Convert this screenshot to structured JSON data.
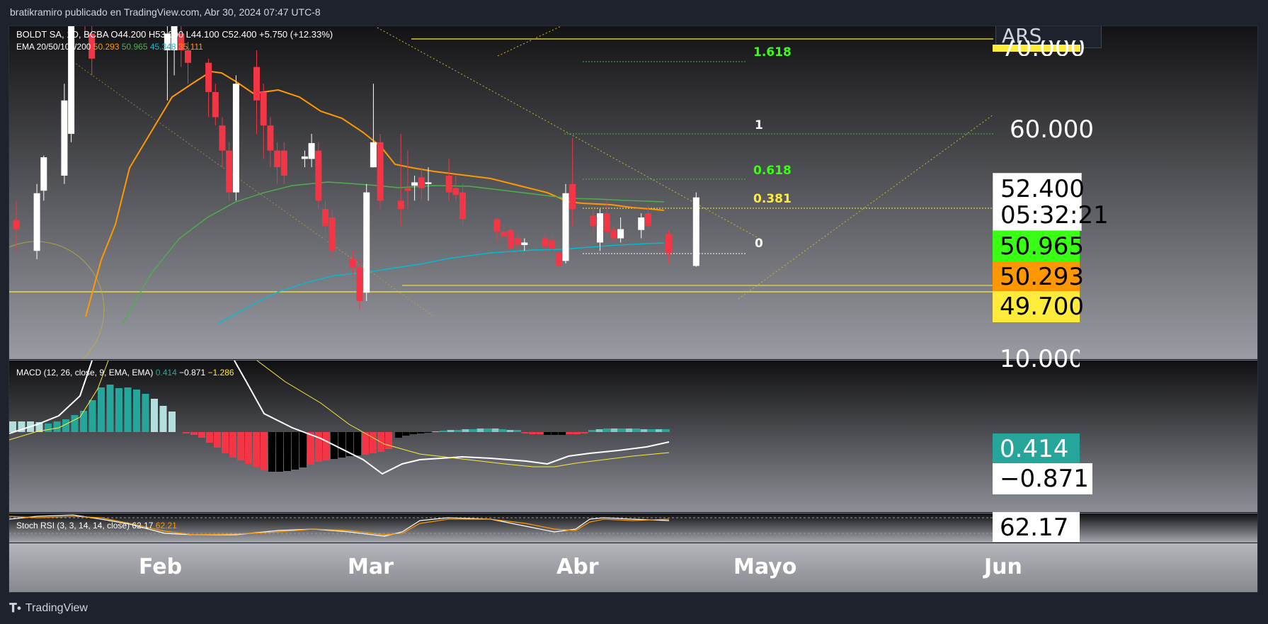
{
  "header": {
    "text": "bratikramiro publicado en TradingView.com, Abr 30, 2024 07:47 UTC-8"
  },
  "footer": {
    "brand": "TradingView"
  },
  "main": {
    "symbol_line": "BOLDT SA, 1D, BCBA  O44.200  H53.000  L44.100  C52.400  +5.750 (+12.33%)",
    "ema_label": "EMA 20/50/100/200",
    "ema_values": [
      "50.293",
      "50.965",
      "45.348",
      "35.111"
    ],
    "currency": "ARS",
    "price_axis": [
      "70.000",
      "60.000",
      "10.000"
    ],
    "last_price": "52.400",
    "countdown": "05:32:21",
    "ema50_tag": "50.965",
    "ema20_tag": "50.293",
    "level_tag": "49.700",
    "fib": [
      "1.618",
      "1",
      "0.618",
      "0.381",
      "0"
    ]
  },
  "macd": {
    "label": "MACD (12, 26, close, 9, EMA, EMA)",
    "values": [
      "0.414",
      "−0.871",
      "−1.286"
    ],
    "hist_tag": "0.414",
    "macd_tag": "−0.871"
  },
  "rsi": {
    "label": "Stoch RSI (3, 3, 14, 14, close)",
    "values": [
      "62.17",
      "62.21"
    ],
    "tag": "62.17"
  },
  "time_axis": [
    "Feb",
    "Mar",
    "Abr",
    "Mayo",
    "Jun"
  ],
  "colors": {
    "up": "#ffffff",
    "down": "#f23645",
    "ema20": "#ff9800",
    "ema50": "#4caf50",
    "ema100": "#00bcd4",
    "ema50_tag": "#39ff14",
    "ema20_tag": "#ff9800",
    "level_tag": "#ffeb3b",
    "macd_tag": "#26a69a"
  },
  "chart_data": {
    "type": "candlestick",
    "candles": [
      {
        "d": "2024-01-22",
        "o": 49.7,
        "c": 48.6,
        "h": 52,
        "l": 46
      },
      {
        "d": "2024-01-25",
        "o": 46,
        "c": 52.9,
        "h": 54,
        "l": 45
      },
      {
        "d": "2024-01-26",
        "o": 53.2,
        "c": 57.2,
        "h": 57.4,
        "l": 52
      },
      {
        "d": "2024-01-29",
        "o": 55,
        "c": 64,
        "h": 66,
        "l": 54
      },
      {
        "d": "2024-01-30",
        "o": 60,
        "c": 80,
        "h": 82,
        "l": 59
      },
      {
        "d": "2024-02-01",
        "o": 78,
        "c": 75,
        "h": 82,
        "l": 72
      },
      {
        "d": "2024-02-02",
        "o": 72,
        "c": 69,
        "h": 74,
        "l": 67
      },
      {
        "d": "2024-02-13",
        "o": 70,
        "c": 72,
        "h": 74,
        "l": 64
      },
      {
        "d": "2024-02-14",
        "o": 70,
        "c": 75,
        "h": 76,
        "l": 67
      },
      {
        "d": "2024-02-15",
        "o": 72,
        "c": 70,
        "h": 74,
        "l": 68
      },
      {
        "d": "2024-02-16",
        "o": 70,
        "c": 68.5,
        "h": 71,
        "l": 66
      },
      {
        "d": "2024-02-19",
        "o": 68.5,
        "c": 65,
        "h": 69,
        "l": 62
      },
      {
        "d": "2024-02-20",
        "o": 65,
        "c": 62,
        "h": 66,
        "l": 61
      },
      {
        "d": "2024-02-21",
        "o": 61,
        "c": 58,
        "h": 62,
        "l": 56
      },
      {
        "d": "2024-02-22",
        "o": 58,
        "c": 53,
        "h": 59,
        "l": 52
      },
      {
        "d": "2024-02-23",
        "o": 53,
        "c": 66,
        "h": 67,
        "l": 52
      },
      {
        "d": "2024-02-26",
        "o": 68,
        "c": 64,
        "h": 70,
        "l": 60
      },
      {
        "d": "2024-02-27",
        "o": 65,
        "c": 61,
        "h": 66,
        "l": 57
      },
      {
        "d": "2024-02-28",
        "o": 61,
        "c": 58,
        "h": 62,
        "l": 56
      },
      {
        "d": "2024-02-29",
        "o": 58,
        "c": 56,
        "h": 59,
        "l": 54
      },
      {
        "d": "2024-03-01",
        "o": 58,
        "c": 55,
        "h": 59,
        "l": 54
      },
      {
        "d": "2024-03-04",
        "o": 57,
        "c": 57.3,
        "h": 58,
        "l": 56
      },
      {
        "d": "2024-03-05",
        "o": 57,
        "c": 58.9,
        "h": 60,
        "l": 56
      },
      {
        "d": "2024-03-06",
        "o": 58,
        "c": 52,
        "h": 59,
        "l": 51
      },
      {
        "d": "2024-03-07",
        "o": 51,
        "c": 49,
        "h": 52,
        "l": 47
      },
      {
        "d": "2024-03-08",
        "o": 50,
        "c": 46,
        "h": 51,
        "l": 45
      },
      {
        "d": "2024-03-11",
        "o": 45,
        "c": 44,
        "h": 46,
        "l": 43
      },
      {
        "d": "2024-03-12",
        "o": 44,
        "c": 40,
        "h": 45,
        "l": 39
      },
      {
        "d": "2024-03-13",
        "o": 41,
        "c": 53,
        "h": 54,
        "l": 40
      },
      {
        "d": "2024-03-14",
        "o": 56,
        "c": 59,
        "h": 66,
        "l": 56
      },
      {
        "d": "2024-03-15",
        "o": 59,
        "c": 52,
        "h": 60,
        "l": 51
      },
      {
        "d": "2024-03-18",
        "o": 52,
        "c": 51,
        "h": 60,
        "l": 49
      },
      {
        "d": "2024-03-19",
        "o": 53.5,
        "c": 53.2,
        "h": 58,
        "l": 51
      },
      {
        "d": "2024-03-20",
        "o": 53.8,
        "c": 54.2,
        "h": 55,
        "l": 52
      },
      {
        "d": "2024-03-21",
        "o": 54.8,
        "c": 53.5,
        "h": 56,
        "l": 52
      },
      {
        "d": "2024-03-22",
        "o": 54,
        "c": 54.2,
        "h": 56,
        "l": 52
      },
      {
        "d": "2024-03-25",
        "o": 55,
        "c": 53,
        "h": 57,
        "l": 52
      },
      {
        "d": "2024-03-26",
        "o": 53.5,
        "c": 52.7,
        "h": 55,
        "l": 52
      },
      {
        "d": "2024-03-27",
        "o": 53,
        "c": 49.8,
        "h": 54,
        "l": 49
      },
      {
        "d": "2024-04-01",
        "o": 49.8,
        "c": 48.3,
        "h": 50,
        "l": 47
      },
      {
        "d": "2024-04-02",
        "o": 48.3,
        "c": 47.7,
        "h": 49,
        "l": 47
      },
      {
        "d": "2024-04-03",
        "o": 48.5,
        "c": 46.3,
        "h": 49,
        "l": 45.5
      },
      {
        "d": "2024-04-04",
        "o": 47.5,
        "c": 46.7,
        "h": 48,
        "l": 45.5
      },
      {
        "d": "2024-04-05",
        "o": 46.7,
        "c": 47,
        "h": 47.5,
        "l": 46
      },
      {
        "d": "2024-04-08",
        "o": 47.5,
        "c": 46.5,
        "h": 48,
        "l": 45.5
      },
      {
        "d": "2024-04-09",
        "o": 47.3,
        "c": 46.2,
        "h": 48,
        "l": 45.5
      },
      {
        "d": "2024-04-10",
        "o": 45.8,
        "c": 44.2,
        "h": 46,
        "l": 44
      },
      {
        "d": "2024-04-11",
        "o": 44.8,
        "c": 52.9,
        "h": 54,
        "l": 44.5
      },
      {
        "d": "2024-04-12",
        "o": 54,
        "c": 51,
        "h": 59.5,
        "l": 49
      },
      {
        "d": "2024-04-15",
        "o": 50.2,
        "c": 49,
        "h": 51,
        "l": 48
      },
      {
        "d": "2024-04-16",
        "o": 47,
        "c": 50.5,
        "h": 51,
        "l": 46
      },
      {
        "d": "2024-04-17",
        "o": 50.5,
        "c": 48.3,
        "h": 52,
        "l": 48
      },
      {
        "d": "2024-04-18",
        "o": 48.5,
        "c": 47.5,
        "h": 49,
        "l": 47
      },
      {
        "d": "2024-04-19",
        "o": 47.5,
        "c": 48.6,
        "h": 50,
        "l": 47
      },
      {
        "d": "2024-04-22",
        "o": 48.5,
        "c": 50,
        "h": 50.5,
        "l": 47.5
      },
      {
        "d": "2024-04-23",
        "o": 50.5,
        "c": 49,
        "h": 51.5,
        "l": 48.5
      },
      {
        "d": "2024-04-26",
        "o": 48,
        "c": 45.7,
        "h": 48.5,
        "l": 44.5
      },
      {
        "d": "2024-04-30",
        "o": 44.2,
        "c": 52.4,
        "h": 53,
        "l": 44.1
      }
    ]
  }
}
